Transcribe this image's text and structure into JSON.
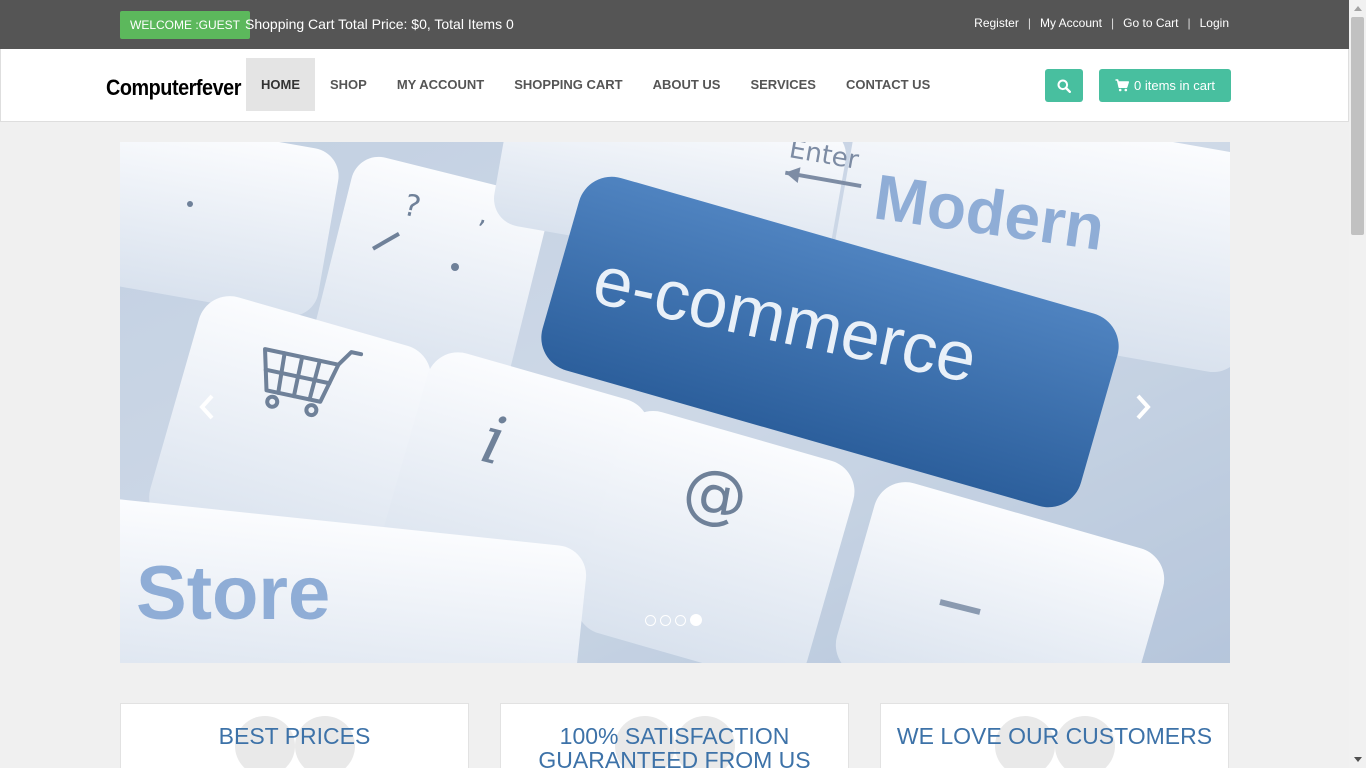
{
  "topbar": {
    "welcome_label": "WELCOME :GUEST",
    "cart_summary": "Shopping Cart Total Price: $0, Total Items 0",
    "links": [
      "Register",
      "My Account",
      "Go to Cart",
      "Login"
    ],
    "separator": "|"
  },
  "navbar": {
    "brand": "Computerfever",
    "menu": [
      {
        "label": "HOME",
        "active": true
      },
      {
        "label": "SHOP"
      },
      {
        "label": "MY ACCOUNT"
      },
      {
        "label": "SHOPPING CART"
      },
      {
        "label": "ABOUT US"
      },
      {
        "label": "SERVICES"
      },
      {
        "label": "CONTACT US"
      }
    ],
    "search_icon": "search-icon",
    "cart_button_label": "0 items in cart",
    "cart_icon": "shopping-cart-icon"
  },
  "carousel": {
    "slide_texts": {
      "key_enter": "Enter",
      "word_modern": "Modern",
      "word_ecommerce": "e-commerce",
      "word_store": "Store",
      "key_question": "?",
      "key_info": "i",
      "key_at": "@"
    },
    "slide_count": 4,
    "active_slide": 4,
    "prev_icon": "chevron-left-icon",
    "next_icon": "chevron-right-icon"
  },
  "features": [
    {
      "title": "BEST PRICES"
    },
    {
      "title": "100% SATISFACTION GUARANTEED FROM US"
    },
    {
      "title": "WE LOVE OUR CUSTOMERS"
    }
  ],
  "colors": {
    "topbar_bg": "#555555",
    "welcome_bg": "#5cb85c",
    "accent_teal": "#48bf9f",
    "feature_title": "#3d72a8",
    "page_bg": "#f0f0f0"
  }
}
